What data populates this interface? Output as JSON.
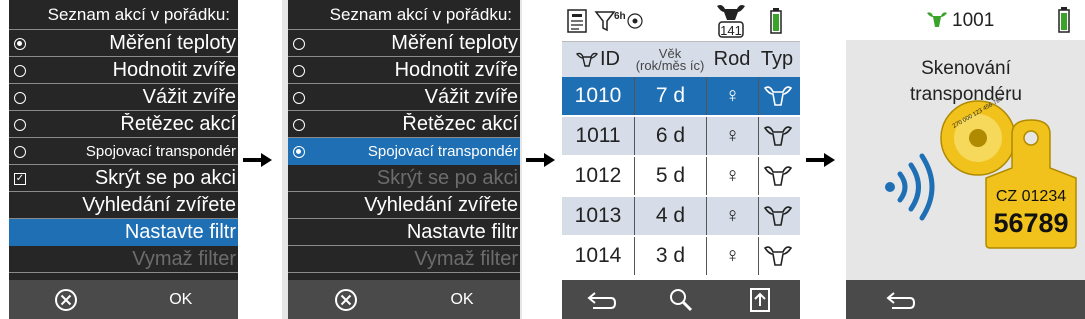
{
  "screen1": {
    "title": "Seznam akcí v pořádku:",
    "items": [
      {
        "label": "Měření teploty",
        "mark": "radio-on"
      },
      {
        "label": "Hodnotit zvíře",
        "mark": "radio"
      },
      {
        "label": "Vážit zvíře",
        "mark": "radio"
      },
      {
        "label": "Řetězec akcí",
        "mark": "radio"
      },
      {
        "label": "Spojovací transpondér",
        "mark": "radio"
      },
      {
        "label": "Skrýt se po akci",
        "mark": "check"
      },
      {
        "label": "Vyhledání zvířete",
        "mark": ""
      },
      {
        "label": "Nastavte filtr",
        "mark": ""
      },
      {
        "label": "Vymaž filter",
        "mark": ""
      }
    ],
    "ok_label": "OK"
  },
  "screen2": {
    "title": "Seznam akcí v pořádku:",
    "items": [
      {
        "label": "Měření teploty",
        "mark": "radio"
      },
      {
        "label": "Hodnotit zvíře",
        "mark": "radio"
      },
      {
        "label": "Vážit zvíře",
        "mark": "radio"
      },
      {
        "label": "Řetězec akcí",
        "mark": "radio"
      },
      {
        "label": "Spojovací transpondér",
        "mark": "radio-on"
      },
      {
        "label": "Skrýt se po akci",
        "mark": ""
      },
      {
        "label": "Vyhledání zvířete",
        "mark": ""
      },
      {
        "label": "Nastavte filtr",
        "mark": ""
      },
      {
        "label": "Vymaž filter",
        "mark": ""
      }
    ],
    "ok_label": "OK"
  },
  "screen3": {
    "filter_badge": "6h",
    "count": "141",
    "headers": {
      "id": "ID",
      "age": "Věk (rok/měs íc)",
      "sex": "Rod",
      "type": "Typ"
    },
    "rows": [
      {
        "id": "1010",
        "age": "7 d",
        "sex": "♀"
      },
      {
        "id": "1011",
        "age": "6 d",
        "sex": "♀"
      },
      {
        "id": "1012",
        "age": "5 d",
        "sex": "♀"
      },
      {
        "id": "1013",
        "age": "4 d",
        "sex": "♀"
      },
      {
        "id": "1014",
        "age": "3 d",
        "sex": "♀"
      }
    ]
  },
  "screen4": {
    "animal_id": "1001",
    "message": "Skenování transpondéru",
    "tag_small": "CZ 01234",
    "tag_big": "56789",
    "button_text": "270 000 123 456 789"
  },
  "colors": {
    "dark_bg": "#262626",
    "footer_bg": "#4a4a4a",
    "highlight": "#1f6fb4",
    "row_alt": "#d6dde8",
    "scan_blue": "#1f6fb4",
    "tag_yellow": "#f1c21b",
    "battery_green": "#3aa329"
  }
}
